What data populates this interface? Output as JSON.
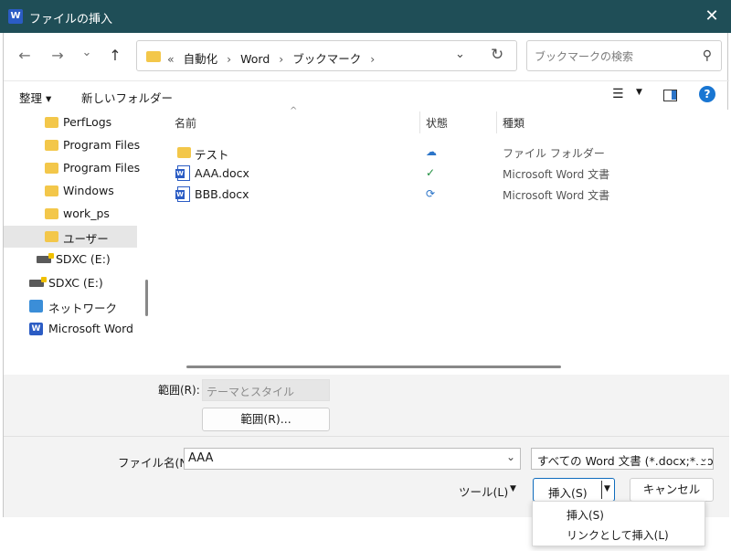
{
  "window": {
    "title": "ファイルの挿入",
    "app_icon": "word-icon",
    "close": "✕"
  },
  "nav": {
    "back": "←",
    "forward": "→",
    "recent": "⌄",
    "up": "↑",
    "address": {
      "parts": [
        "«",
        "自動化",
        "›",
        "Word",
        "›",
        "ブックマーク",
        "›"
      ]
    },
    "search_placeholder": "ブックマークの検索"
  },
  "toolbar": {
    "organize": "整理 ▾",
    "new_folder": "新しいフォルダー"
  },
  "sidebar": {
    "items": [
      {
        "label": "PerfLogs",
        "icon": "folder-icon"
      },
      {
        "label": "Program Files",
        "icon": "folder-icon"
      },
      {
        "label": "Program Files (",
        "icon": "folder-icon"
      },
      {
        "label": "Windows",
        "icon": "folder-icon"
      },
      {
        "label": "work_ps",
        "icon": "folder-icon"
      },
      {
        "label": "ユーザー",
        "icon": "folder-icon",
        "selected": true
      },
      {
        "label": "SDXC (E:)",
        "icon": "drive-icon"
      },
      {
        "label": "SDXC (E:)",
        "icon": "drive-icon"
      },
      {
        "label": "ネットワーク",
        "icon": "network-icon"
      },
      {
        "label": "Microsoft Word",
        "icon": "word-icon"
      }
    ]
  },
  "filelist": {
    "columns": {
      "name": "名前",
      "status": "状態",
      "type": "種類"
    },
    "sort_caret": "^",
    "rows": [
      {
        "name": "テスト",
        "icon": "folder-icon",
        "status": "☁",
        "status_icon": "cloud-icon",
        "type": "ファイル フォルダー"
      },
      {
        "name": "AAA.docx",
        "icon": "word-doc-icon",
        "status": "✓",
        "status_icon": "synced-check-icon",
        "type": "Microsoft Word 文書"
      },
      {
        "name": "BBB.docx",
        "icon": "word-doc-icon",
        "status": "⟳",
        "status_icon": "sync-icon",
        "type": "Microsoft Word 文書"
      }
    ]
  },
  "range": {
    "label": "範囲(R):",
    "placeholder": "テーマとスタイル",
    "button": "範囲(R)..."
  },
  "bottom": {
    "filename_label": "ファイル名(N):",
    "filename_value": "AAA",
    "filter": "すべての Word 文書 (*.docx;*.doc",
    "tools": "ツール(L)",
    "insert": "挿入(S)",
    "cancel": "キャンセル"
  },
  "dropdown": {
    "items": [
      "挿入(S)",
      "リンクとして挿入(L)"
    ]
  },
  "colors": {
    "titlebar": "#1f4e57",
    "accent": "#0f6cbd",
    "folder": "#f3c74a",
    "word": "#2b5cc4"
  }
}
